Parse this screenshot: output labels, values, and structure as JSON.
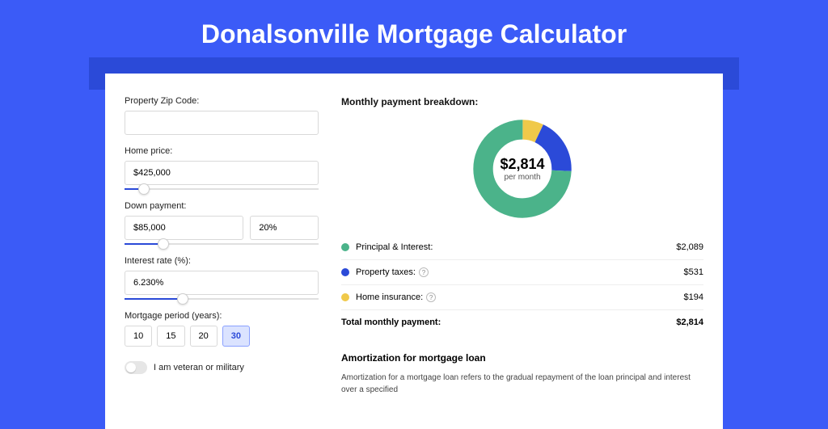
{
  "title": "Donalsonville Mortgage Calculator",
  "form": {
    "zip_label": "Property Zip Code:",
    "zip_value": "",
    "price_label": "Home price:",
    "price_value": "$425,000",
    "down_label": "Down payment:",
    "down_value": "$85,000",
    "down_pct": "20%",
    "rate_label": "Interest rate (%):",
    "rate_value": "6.230%",
    "period_label": "Mortgage period (years):",
    "periods": [
      "10",
      "15",
      "20",
      "30"
    ],
    "period_active_index": 3,
    "veteran_label": "I am veteran or military"
  },
  "breakdown": {
    "title": "Monthly payment breakdown:",
    "total_display": "$2,814",
    "total_sub": "per month",
    "items": [
      {
        "label": "Principal & Interest:",
        "value": "$2,089",
        "color": "#4bb38a",
        "info": false,
        "num": 2089
      },
      {
        "label": "Property taxes:",
        "value": "$531",
        "color": "#2b4ad8",
        "info": true,
        "num": 531
      },
      {
        "label": "Home insurance:",
        "value": "$194",
        "color": "#f0c94a",
        "info": true,
        "num": 194
      }
    ],
    "total_label": "Total monthly payment:",
    "total_value": "$2,814"
  },
  "amortization": {
    "title": "Amortization for mortgage loan",
    "body": "Amortization for a mortgage loan refers to the gradual repayment of the loan principal and interest over a specified"
  },
  "chart_data": {
    "type": "pie",
    "title": "Monthly payment breakdown",
    "series": [
      {
        "name": "Principal & Interest",
        "value": 2089,
        "color": "#4bb38a"
      },
      {
        "name": "Property taxes",
        "value": 531,
        "color": "#2b4ad8"
      },
      {
        "name": "Home insurance",
        "value": 194,
        "color": "#f0c94a"
      }
    ],
    "center_label": "$2,814 per month"
  }
}
